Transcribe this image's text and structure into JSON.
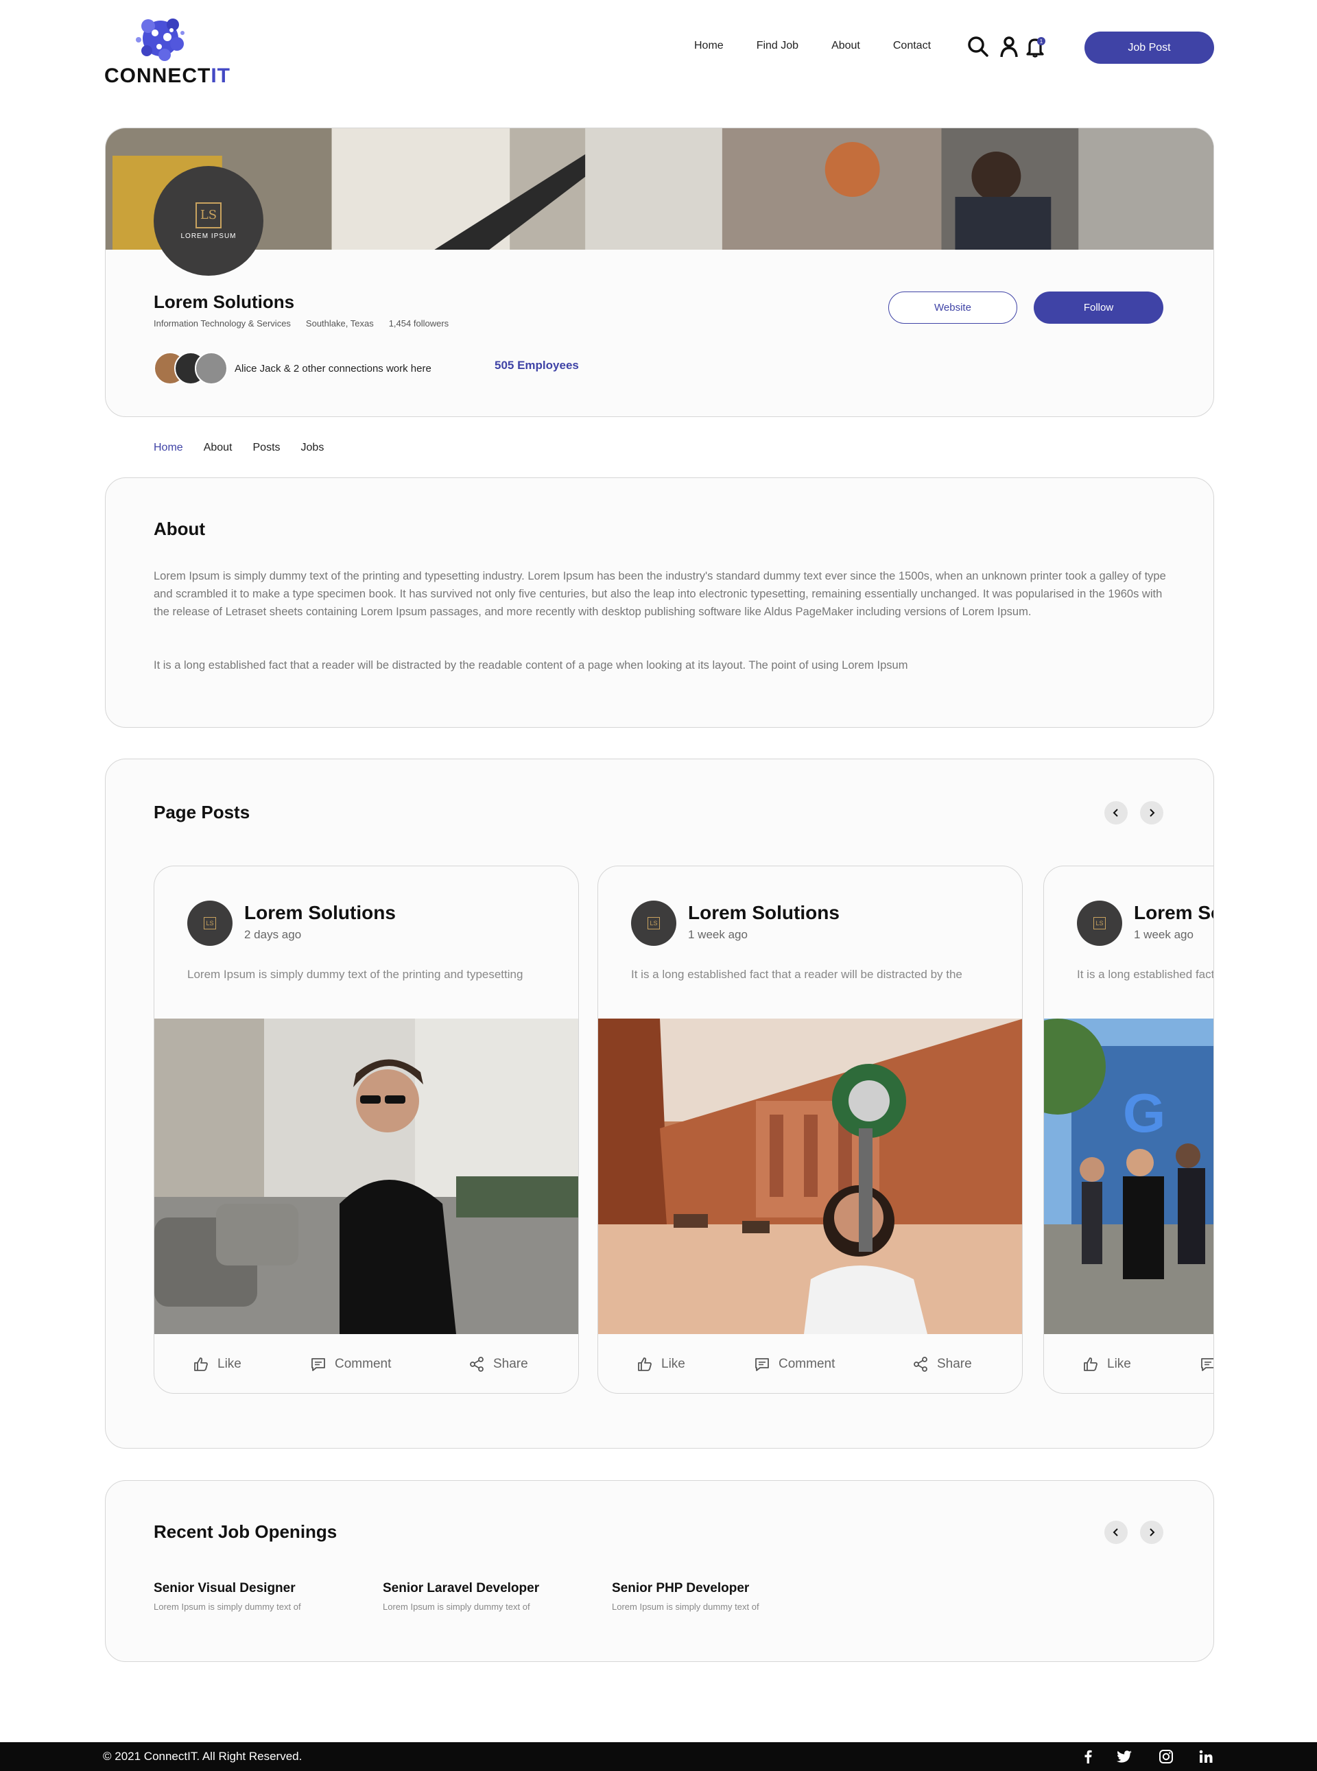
{
  "brand": {
    "logo_main": "CONNECT",
    "logo_accent": "IT",
    "accent_color": "#3f43a6"
  },
  "nav": {
    "items": [
      "Home",
      "Find Job",
      "About",
      "Contact"
    ],
    "job_post_label": "Job Post",
    "notification_count": "1"
  },
  "profile": {
    "avatar_initials": "LS",
    "avatar_caption": "LOREM IPSUM",
    "name": "Lorem Solutions",
    "industry": "Information Technology & Services",
    "location": "Southlake, Texas",
    "followers": "1,454 followers",
    "connections_text": "Alice Jack & 2 other connections work here",
    "employees": "505 Employees",
    "website_label": "Website",
    "follow_label": "Follow"
  },
  "tabs": [
    "Home",
    "About",
    "Posts",
    "Jobs"
  ],
  "about": {
    "title": "About",
    "paragraph1": "Lorem Ipsum is simply dummy text of the printing and typesetting industry. Lorem Ipsum has been the industry's standard dummy text ever since the 1500s, when an unknown printer took a galley of type and scrambled it to make a type specimen book. It has survived not only five centuries, but also the leap into electronic typesetting, remaining essentially unchanged. It was popularised in the 1960s with the release of Letraset sheets containing Lorem Ipsum passages, and more recently with desktop publishing software like Aldus PageMaker including versions of Lorem Ipsum.",
    "paragraph2": "It is a long established fact that a reader will be distracted by the readable content of a page when looking at its layout. The point of using Lorem Ipsum"
  },
  "posts": {
    "title": "Page Posts",
    "items": [
      {
        "author": "Lorem Solutions",
        "time": "2 days ago",
        "text": "Lorem Ipsum is simply dummy text of the printing and typesetting"
      },
      {
        "author": "Lorem Solutions",
        "time": "1 week ago",
        "text": "It is a long established fact that a reader will be distracted by the"
      },
      {
        "author": "Lorem Solutions",
        "time": "1 week ago",
        "text": "It is a long established fact that a reader will be distracted by the"
      }
    ],
    "actions": {
      "like": "Like",
      "comment": "Comment",
      "share": "Share"
    }
  },
  "jobs": {
    "title": "Recent Job Openings",
    "items": [
      {
        "title": "Senior Visual Designer",
        "desc": "Lorem Ipsum is simply dummy text of"
      },
      {
        "title": "Senior Laravel Developer",
        "desc": "Lorem Ipsum is simply dummy text of"
      },
      {
        "title": "Senior PHP Developer",
        "desc": "Lorem Ipsum is simply dummy text of"
      }
    ]
  },
  "footer": {
    "copyright": "© 2021 ConnectIT. All Right Reserved."
  }
}
